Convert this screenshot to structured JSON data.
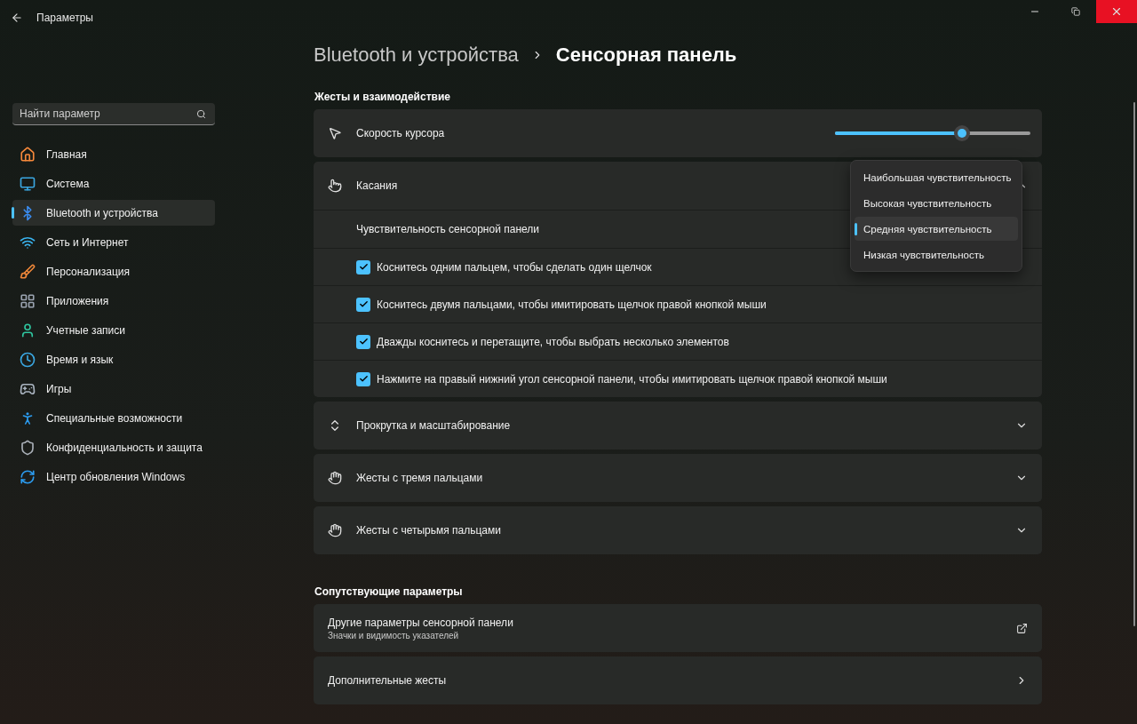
{
  "window": {
    "title": "Параметры"
  },
  "search": {
    "placeholder": "Найти параметр"
  },
  "nav": [
    {
      "label": "Главная",
      "kind": "home",
      "selected": false
    },
    {
      "label": "Система",
      "kind": "system",
      "selected": false
    },
    {
      "label": "Bluetooth и устройства",
      "kind": "bluetooth",
      "selected": true
    },
    {
      "label": "Сеть и Интернет",
      "kind": "network",
      "selected": false
    },
    {
      "label": "Персонализация",
      "kind": "brush",
      "selected": false
    },
    {
      "label": "Приложения",
      "kind": "apps",
      "selected": false
    },
    {
      "label": "Учетные записи",
      "kind": "account",
      "selected": false
    },
    {
      "label": "Время и язык",
      "kind": "time",
      "selected": false
    },
    {
      "label": "Игры",
      "kind": "games",
      "selected": false
    },
    {
      "label": "Специальные возможности",
      "kind": "accessibility",
      "selected": false
    },
    {
      "label": "Конфиденциальность и защита",
      "kind": "privacy",
      "selected": false
    },
    {
      "label": "Центр обновления Windows",
      "kind": "update",
      "selected": false
    }
  ],
  "breadcrumb": {
    "parent": "Bluetooth и устройства",
    "current": "Сенсорная панель"
  },
  "gestures": {
    "title": "Жесты и взаимодействие",
    "cursor_speed": {
      "label": "Скорость курсора",
      "level": 0.65
    },
    "taps": {
      "label": "Касания",
      "expanded": true,
      "sensitivity_label": "Чувствительность сенсорной панели",
      "sensitivity_options": [
        {
          "label": "Наибольшая чувствительность",
          "selected": false
        },
        {
          "label": "Высокая чувствительность",
          "selected": false
        },
        {
          "label": "Средняя чувствительность",
          "selected": true
        },
        {
          "label": "Низкая чувствительность",
          "selected": false
        }
      ],
      "options": [
        {
          "label": "Коснитесь одним пальцем, чтобы сделать один щелчок",
          "checked": true
        },
        {
          "label": "Коснитесь двумя пальцами, чтобы имитировать щелчок правой кнопкой мыши",
          "checked": true
        },
        {
          "label": "Дважды коснитесь и перетащите, чтобы выбрать несколько элементов",
          "checked": true
        },
        {
          "label": "Нажмите на правый нижний угол сенсорной панели, чтобы имитировать щелчок правой кнопкой мыши",
          "checked": true
        }
      ]
    },
    "groups": [
      {
        "label": "Прокрутка и масштабирование",
        "kind": "scroll",
        "expanded": false
      },
      {
        "label": "Жесты с тремя пальцами",
        "kind": "three",
        "expanded": false
      },
      {
        "label": "Жесты с четырьмя пальцами",
        "kind": "four",
        "expanded": false
      }
    ]
  },
  "related": {
    "title": "Сопутствующие параметры",
    "items": [
      {
        "title": "Другие параметры сенсорной панели",
        "subtitle": "Значки и видимость указателей",
        "kind": "external"
      },
      {
        "title": "Дополнительные жесты",
        "kind": "link"
      }
    ]
  }
}
